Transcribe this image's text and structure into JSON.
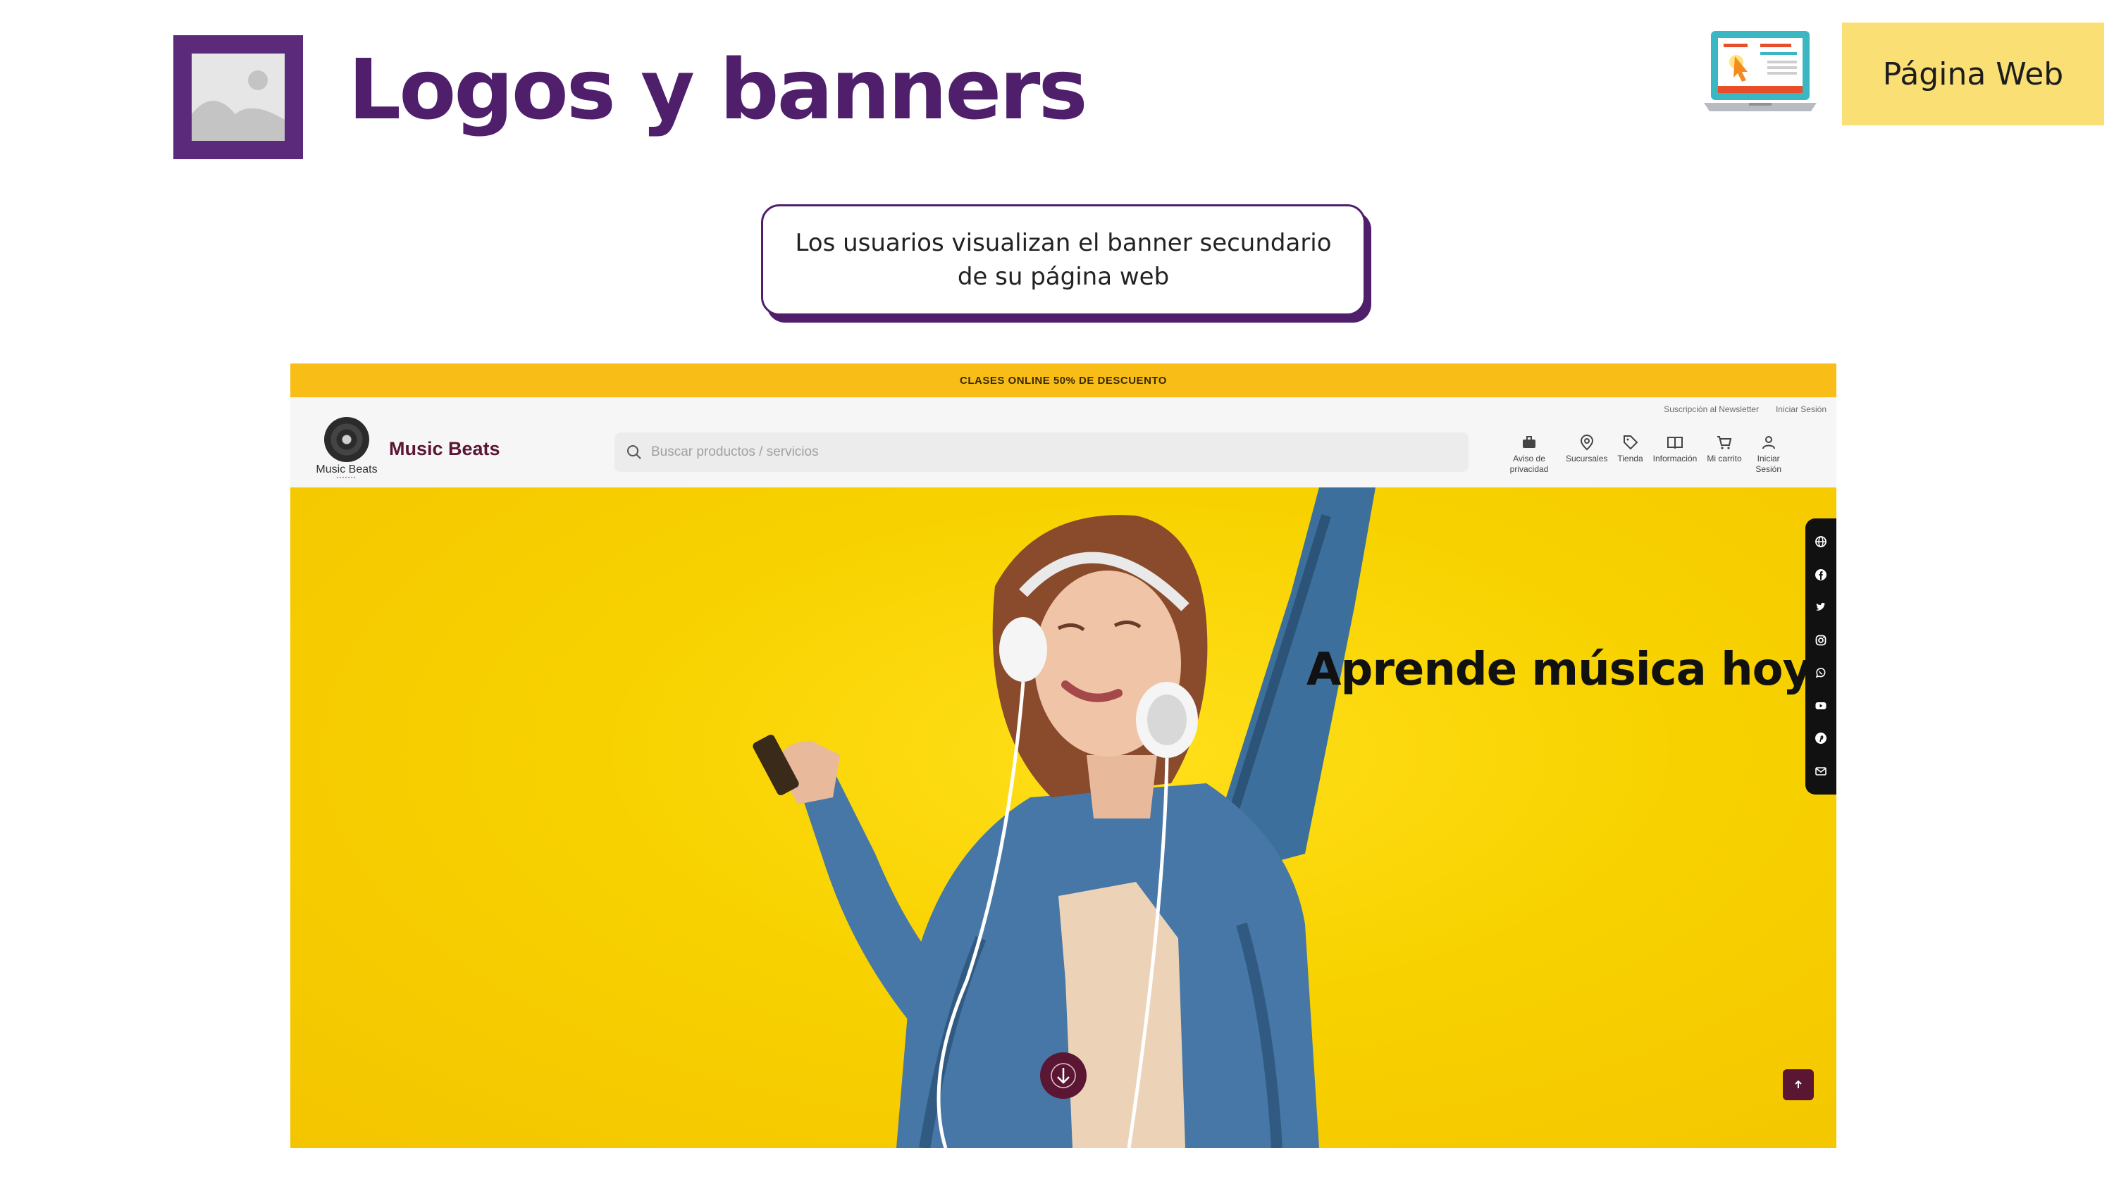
{
  "slide": {
    "title": "Logos y banners",
    "tag": "Página Web",
    "callout": "Los usuarios visualizan el  banner secundario de su página web"
  },
  "colors": {
    "brand_purple": "#4f1f6c",
    "tag_yellow": "#fadf75",
    "promo_yellow": "#f9bd17",
    "hero_yellow": "#f8d200",
    "site_accent": "#5a1633"
  },
  "site": {
    "promo_bar": "CLASES ONLINE 50% DE DESCUENTO",
    "top_links": [
      "Suscripción al Newsletter",
      "Iniciar Sesión"
    ],
    "logo_text": "Music Beats",
    "brand_name": "Music Beats",
    "search_placeholder": "Buscar productos / servicios",
    "nav": [
      {
        "icon": "briefcase-icon",
        "label": "Aviso de privacidad"
      },
      {
        "icon": "location-pin-icon",
        "label": "Sucursales"
      },
      {
        "icon": "tag-icon",
        "label": "Tienda"
      },
      {
        "icon": "book-icon",
        "label": "Información"
      },
      {
        "icon": "cart-icon",
        "label": "Mi carrito"
      },
      {
        "icon": "user-icon",
        "label": "Iniciar Sesión"
      }
    ],
    "hero_title": "Aprende música hoy",
    "social_icons": [
      "globe-icon",
      "facebook-icon",
      "twitter-icon",
      "instagram-icon",
      "whatsapp-icon",
      "youtube-icon",
      "pinterest-icon",
      "email-icon"
    ]
  }
}
